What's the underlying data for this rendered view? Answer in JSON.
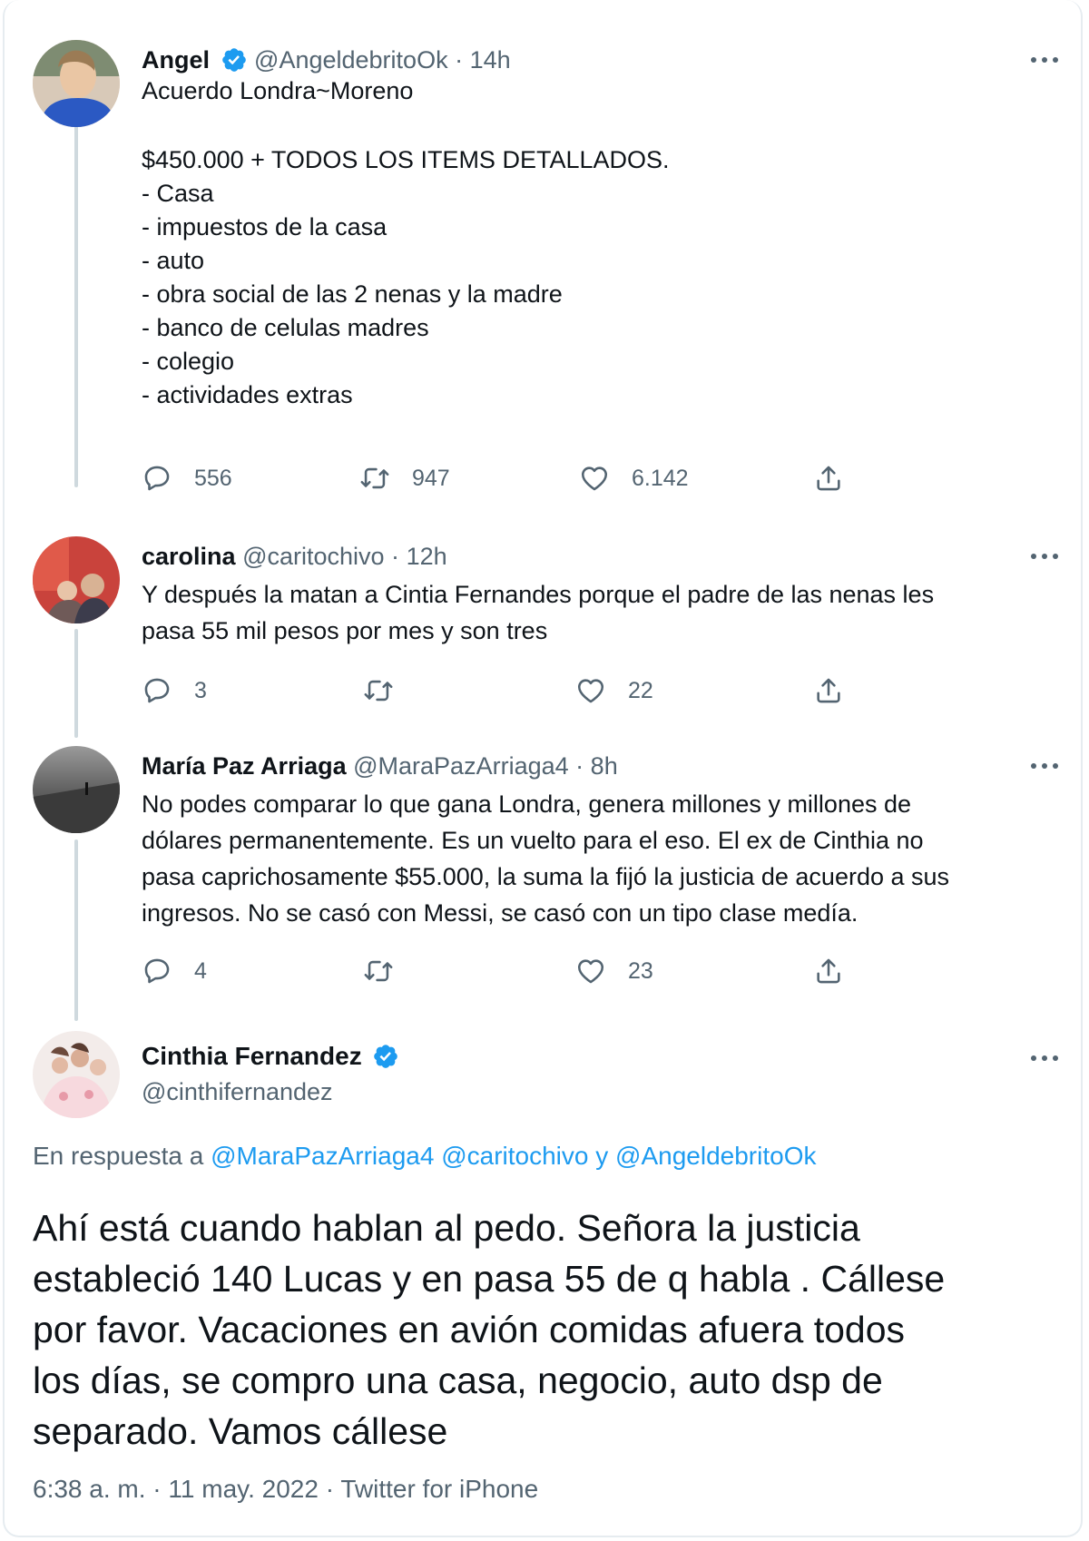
{
  "tweets": [
    {
      "name": "Angel",
      "handle": "@AngeldebritoOk",
      "time": "14h",
      "verified": true,
      "lines": [
        "Acuerdo Londra~Moreno",
        "",
        "$450.000 + TODOS LOS ITEMS DETALLADOS.",
        "- Casa",
        "- impuestos de la casa",
        "- auto",
        "- obra social de las 2 nenas y la madre",
        "- banco de celulas madres",
        "- colegio",
        "- actividades extras"
      ],
      "replies": "556",
      "retweets": "947",
      "likes": "6.142"
    },
    {
      "name": "carolina",
      "handle": "@caritochivo",
      "time": "12h",
      "verified": false,
      "lines": [
        "Y después la matan a Cintia Fernandes porque el padre de las nenas les",
        "pasa 55 mil pesos por mes y son tres"
      ],
      "replies": "3",
      "retweets": "",
      "likes": "22"
    },
    {
      "name": "María Paz Arriaga",
      "handle": "@MaraPazArriaga4",
      "time": "8h",
      "verified": false,
      "lines": [
        "No podes comparar lo que gana Londra, genera millones y millones de",
        "dólares permanentemente. Es un vuelto para el eso. El ex de Cinthia no",
        "pasa caprichosamente $55.000, la suma la fijó la justicia de acuerdo a sus",
        "ingresos. No se casó con Messi, se casó con un tipo clase medía."
      ],
      "replies": "4",
      "retweets": "",
      "likes": "23"
    }
  ],
  "main": {
    "name": "Cinthia Fernandez",
    "handle": "@cinthifernandez",
    "reply_prefix": "En respuesta a",
    "reply_user1": "@MaraPazArriaga4",
    "reply_user2": "@caritochivo",
    "reply_and": "y",
    "reply_user3": "@AngeldebritoOk",
    "text_lines": [
      "Ahí está cuando hablan al pedo. Señora la justicia",
      "estableció 140 Lucas y en pasa 55 de q habla . Cállese",
      "por favor. Vacaciones en avión comidas afuera todos",
      "los días, se compro una casa, negocio, auto dsp de",
      "separado. Vamos cállese"
    ],
    "time": "6:38 a. m.",
    "date": "11 may. 2022",
    "source": "Twitter for iPhone"
  },
  "colors": {
    "link": "#1d9bf0",
    "muted": "#536471",
    "verified": "#1d9bf0",
    "line": "#cfd9de"
  },
  "icons": [
    "verified-badge-icon",
    "more-icon",
    "reply-icon",
    "retweet-icon",
    "like-icon",
    "share-icon"
  ]
}
